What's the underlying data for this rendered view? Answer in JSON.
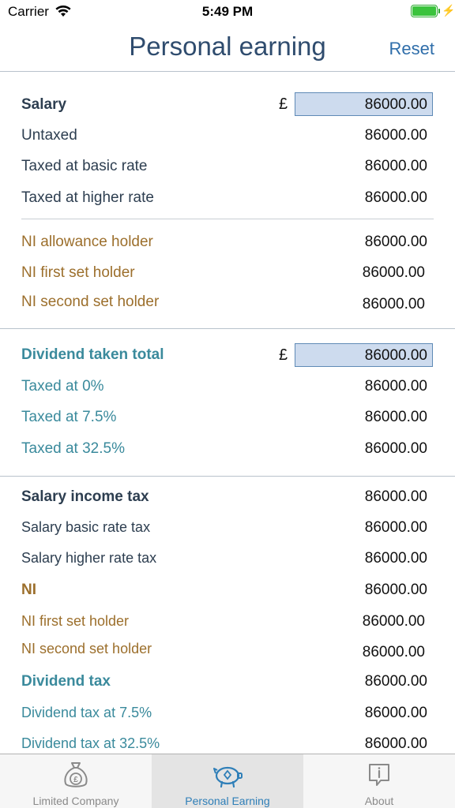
{
  "status": {
    "carrier": "Carrier",
    "time": "5:49 PM"
  },
  "nav": {
    "title": "Personal earning",
    "reset": "Reset"
  },
  "currency_symbol": "£",
  "salary": {
    "label": "Salary",
    "value": "86000.00",
    "rows": [
      {
        "label": "Untaxed",
        "value": "86000.00"
      },
      {
        "label": "Taxed at basic rate",
        "value": "86000.00"
      },
      {
        "label": "Taxed at higher rate",
        "value": "86000.00"
      }
    ]
  },
  "ni": {
    "rows": [
      {
        "label": "NI allowance holder",
        "value": "86000.00"
      },
      {
        "label": "NI first set holder",
        "value": "86000.00"
      },
      {
        "label": "NI second set holder",
        "value": "86000.00"
      }
    ]
  },
  "dividend": {
    "label": "Dividend taken total",
    "value": "86000.00",
    "rows": [
      {
        "label": "Taxed at 0%",
        "value": "86000.00"
      },
      {
        "label": "Taxed at 7.5%",
        "value": "86000.00"
      },
      {
        "label": "Taxed at 32.5%",
        "value": "86000.00"
      }
    ]
  },
  "tax": {
    "salary_income_tax": {
      "label": "Salary income tax",
      "value": "86000.00"
    },
    "salary_basic": {
      "label": "Salary basic rate tax",
      "value": "86000.00"
    },
    "salary_higher": {
      "label": "Salary higher rate tax",
      "value": "86000.00"
    },
    "ni": {
      "label": "NI",
      "value": "86000.00"
    },
    "ni_first": {
      "label": "NI first set holder",
      "value": "86000.00"
    },
    "ni_second": {
      "label": "NI second set holder",
      "value": "86000.00"
    },
    "dividend_tax": {
      "label": "Dividend tax",
      "value": "86000.00"
    },
    "dividend_75": {
      "label": "Dividend tax at 7.5%",
      "value": "86000.00"
    },
    "dividend_325": {
      "label": "Dividend tax at 32.5%",
      "value": "86000.00"
    }
  },
  "tabs": [
    {
      "label": "Limited Company",
      "icon": "money-bag-icon"
    },
    {
      "label": "Personal Earning",
      "icon": "piggy-bank-icon",
      "active": true
    },
    {
      "label": "About",
      "icon": "info-bubble-icon"
    }
  ],
  "colors": {
    "accent": "#2f7fb8",
    "salary": "#2d3e50",
    "ni": "#9c6f2c",
    "dividend": "#3a8a9c",
    "input_bg": "#cddbee"
  }
}
